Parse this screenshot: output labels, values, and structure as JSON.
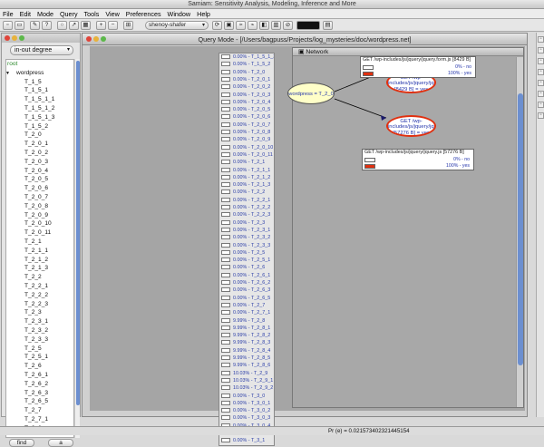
{
  "window": {
    "title": "Samiam: Sensitivity Analysis, Modeling, Inference and More"
  },
  "menu": [
    "File",
    "Edit",
    "Mode",
    "Query",
    "Tools",
    "View",
    "Preferences",
    "Window",
    "Help"
  ],
  "toolbar": {
    "algorithm": "shenoy-shafer",
    "arrow": "▾"
  },
  "left": {
    "sort": "in-out degree",
    "find": "find",
    "a": "a",
    "tree": [
      "root",
      "wordpress",
      "T_1_5",
      "T_1_5_1",
      "T_1_5_1_1",
      "T_1_5_1_2",
      "T_1_5_1_3",
      "T_1_5_2",
      "T_2_0",
      "T_2_0_1",
      "T_2_0_2",
      "T_2_0_3",
      "T_2_0_4",
      "T_2_0_5",
      "T_2_0_6",
      "T_2_0_7",
      "T_2_0_8",
      "T_2_0_9",
      "T_2_0_10",
      "T_2_0_11",
      "T_2_1",
      "T_2_1_1",
      "T_2_1_2",
      "T_2_1_3",
      "T_2_2",
      "T_2_2_1",
      "T_2_2_2",
      "T_2_2_3",
      "T_2_3",
      "T_2_3_1",
      "T_2_3_2",
      "T_2_3_3",
      "T_2_5",
      "T_2_5_1",
      "T_2_6",
      "T_2_6_1",
      "T_2_6_2",
      "T_2_6_3",
      "T_2_6_5",
      "T_2_7",
      "T_2_7_1",
      "T_2_8"
    ]
  },
  "query": {
    "title": "Query Mode - [/Users/bagpuss/Projects/log_mysteries/doc/wordpress.net]",
    "network_title": "Network",
    "nodes": [
      {
        "p": "0.00%",
        "n": "T_1_5_1_3"
      },
      {
        "p": "0.00%",
        "n": "T_1_5_2"
      },
      {
        "p": "0.00%",
        "n": "T_2_0"
      },
      {
        "p": "0.00%",
        "n": "T_2_0_1"
      },
      {
        "p": "0.00%",
        "n": "T_2_0_2"
      },
      {
        "p": "0.00%",
        "n": "T_2_0_3"
      },
      {
        "p": "0.00%",
        "n": "T_2_0_4"
      },
      {
        "p": "0.00%",
        "n": "T_2_0_5"
      },
      {
        "p": "0.00%",
        "n": "T_2_0_6"
      },
      {
        "p": "0.00%",
        "n": "T_2_0_7"
      },
      {
        "p": "0.00%",
        "n": "T_2_0_8"
      },
      {
        "p": "0.00%",
        "n": "T_2_0_9"
      },
      {
        "p": "0.00%",
        "n": "T_2_0_10"
      },
      {
        "p": "0.00%",
        "n": "T_2_0_11"
      },
      {
        "p": "0.00%",
        "n": "T_2_1"
      },
      {
        "p": "0.00%",
        "n": "T_2_1_1"
      },
      {
        "p": "0.00%",
        "n": "T_2_1_2"
      },
      {
        "p": "0.00%",
        "n": "T_2_1_3"
      },
      {
        "p": "0.00%",
        "n": "T_2_2"
      },
      {
        "p": "0.00%",
        "n": "T_2_2_1"
      },
      {
        "p": "0.00%",
        "n": "T_2_2_2"
      },
      {
        "p": "0.00%",
        "n": "T_2_2_3"
      },
      {
        "p": "0.00%",
        "n": "T_2_3"
      },
      {
        "p": "0.00%",
        "n": "T_2_3_1"
      },
      {
        "p": "0.00%",
        "n": "T_2_3_2"
      },
      {
        "p": "0.00%",
        "n": "T_2_3_3"
      },
      {
        "p": "0.00%",
        "n": "T_2_5"
      },
      {
        "p": "0.00%",
        "n": "T_2_5_1"
      },
      {
        "p": "0.00%",
        "n": "T_2_6"
      },
      {
        "p": "0.00%",
        "n": "T_2_6_1"
      },
      {
        "p": "0.00%",
        "n": "T_2_6_2"
      },
      {
        "p": "0.00%",
        "n": "T_2_6_3"
      },
      {
        "p": "0.00%",
        "n": "T_2_6_5"
      },
      {
        "p": "0.00%",
        "n": "T_2_7"
      },
      {
        "p": "0.00%",
        "n": "T_2_7_1"
      },
      {
        "p": "9.99%",
        "n": "T_2_8"
      },
      {
        "p": "9.99%",
        "n": "T_2_8_1"
      },
      {
        "p": "9.99%",
        "n": "T_2_8_2"
      },
      {
        "p": "9.99%",
        "n": "T_2_8_3"
      },
      {
        "p": "9.99%",
        "n": "T_2_8_4"
      },
      {
        "p": "9.99%",
        "n": "T_2_8_5"
      },
      {
        "p": "9.99%",
        "n": "T_2_8_6"
      },
      {
        "p": "10.03%",
        "n": "T_2_9"
      },
      {
        "p": "10.03%",
        "n": "T_2_9_1"
      },
      {
        "p": "10.03%",
        "n": "T_2_9_2"
      },
      {
        "p": "0.00%",
        "n": "T_3_0"
      },
      {
        "p": "0.00%",
        "n": "T_3_0_1"
      },
      {
        "p": "0.00%",
        "n": "T_3_0_2"
      },
      {
        "p": "0.00%",
        "n": "T_3_0_3"
      },
      {
        "p": "0.00%",
        "n": "T_3_0_4"
      },
      {
        "p": "0.00%",
        "n": "T_3_0_5"
      },
      {
        "p": "0.00%",
        "n": "T_3_1"
      }
    ],
    "center_node": "wordpress = T_2_0",
    "ell1": "GET /wp-includes/js/jquery/jquery.form.js [8429 B] = yes",
    "ell2": "GET /wp-includes/js/jquery/jquery.js [57276 B] = yes",
    "box1": {
      "label": "GET /wp-includes/js/jquery/jquery.form.js [8429 B]",
      "no": "0% - no",
      "yes": "100% - yes"
    },
    "box2": {
      "label": "GET /wp-includes/js/jquery/jquery.js [57276 B]",
      "no": "0% - no",
      "yes": "100% - yes"
    }
  },
  "status": "Pr (e) = 0.021573402321445154",
  "colors": {
    "accent": "#2233aa",
    "red": "#e03010",
    "scroll": "#6c8fd0"
  }
}
